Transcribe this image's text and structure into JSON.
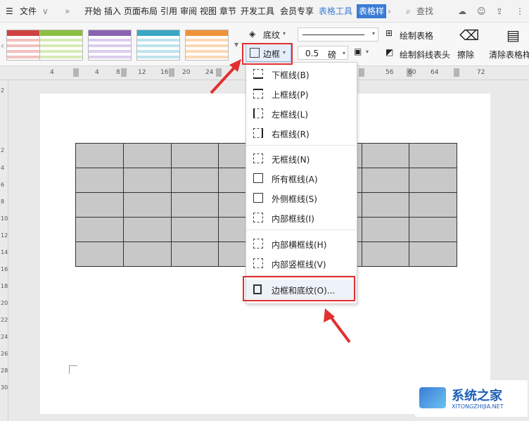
{
  "tabs": {
    "menu_label": "文件",
    "items": [
      "开始",
      "插入",
      "页面布局",
      "引用",
      "审阅",
      "视图",
      "章节",
      "开发工具",
      "会员专享",
      "表格工具",
      "表格样"
    ],
    "search": "查找"
  },
  "ribbon": {
    "shading": "底纹",
    "border": "边框",
    "line_width": "0.5",
    "unit": "磅",
    "draw_table": "绘制表格",
    "draw_diag": "绘制斜线表头",
    "erase": "擦除",
    "clear_style": "清除表格样"
  },
  "ruler": [
    "4",
    "4",
    "8",
    "12",
    "16",
    "20",
    "24",
    "56",
    "60",
    "64",
    "72"
  ],
  "vruler": [
    "2",
    "2",
    "4",
    "6",
    "8",
    "10",
    "12",
    "14",
    "16",
    "18",
    "20",
    "22",
    "24",
    "26",
    "28",
    "30"
  ],
  "menu": {
    "items": [
      "下框线(B)",
      "上框线(P)",
      "左框线(L)",
      "右框线(R)",
      "无框线(N)",
      "所有框线(A)",
      "外侧框线(S)",
      "内部框线(I)",
      "内部横框线(H)",
      "内部竖框线(V)",
      "边框和底纹(O)..."
    ]
  },
  "watermark": {
    "name": "系统之家",
    "url": "XITONGZHIJIA.NET"
  },
  "colors": {
    "accent": "#3a7bd5",
    "highlight": "#e03030",
    "cell": "#c8c8c8"
  }
}
